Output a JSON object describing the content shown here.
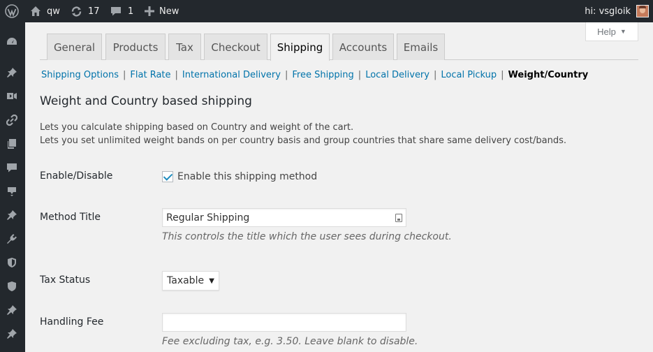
{
  "admin_bar": {
    "site_name": "qw",
    "updates_count": "17",
    "comments_count": "1",
    "new_label": "New",
    "greeting": "hi: vsgloik"
  },
  "side_menu": {
    "icons": [
      "dashboard-icon",
      "pin-icon",
      "media-icon",
      "links-icon",
      "pages-icon",
      "comments-icon",
      "woocommerce-icon",
      "pin-icon",
      "plugins-icon",
      "shield-icon",
      "shield-icon",
      "pin-icon",
      "pin-icon"
    ]
  },
  "help": {
    "label": "Help",
    "caret": "▼"
  },
  "tabs": [
    "General",
    "Products",
    "Tax",
    "Checkout",
    "Shipping",
    "Accounts",
    "Emails"
  ],
  "active_tab": "Shipping",
  "subnav": {
    "links": [
      "Shipping Options",
      "Flat Rate",
      "International Delivery",
      "Free Shipping",
      "Local Delivery",
      "Local Pickup"
    ],
    "current": "Weight/Country",
    "separator": "|"
  },
  "section": {
    "title": "Weight and Country based shipping",
    "description_line1": "Lets you calculate shipping based on Country and weight of the cart.",
    "description_line2": "Lets you set unlimited weight bands on per country basis and group countries that share same delivery cost/bands."
  },
  "fields": {
    "enable": {
      "label": "Enable/Disable",
      "checkbox_label": "Enable this shipping method",
      "checked": true
    },
    "method_title": {
      "label": "Method Title",
      "value": "Regular Shipping",
      "help": "This controls the title which the user sees during checkout."
    },
    "tax_status": {
      "label": "Tax Status",
      "selected": "Taxable",
      "arrow": "▼"
    },
    "handling_fee": {
      "label": "Handling Fee",
      "value": "",
      "help": "Fee excluding tax, e.g. 3.50. Leave blank to disable."
    }
  },
  "colors": {
    "admin_bar": "#23282d",
    "link": "#0073aa",
    "background": "#f1f1f1"
  }
}
